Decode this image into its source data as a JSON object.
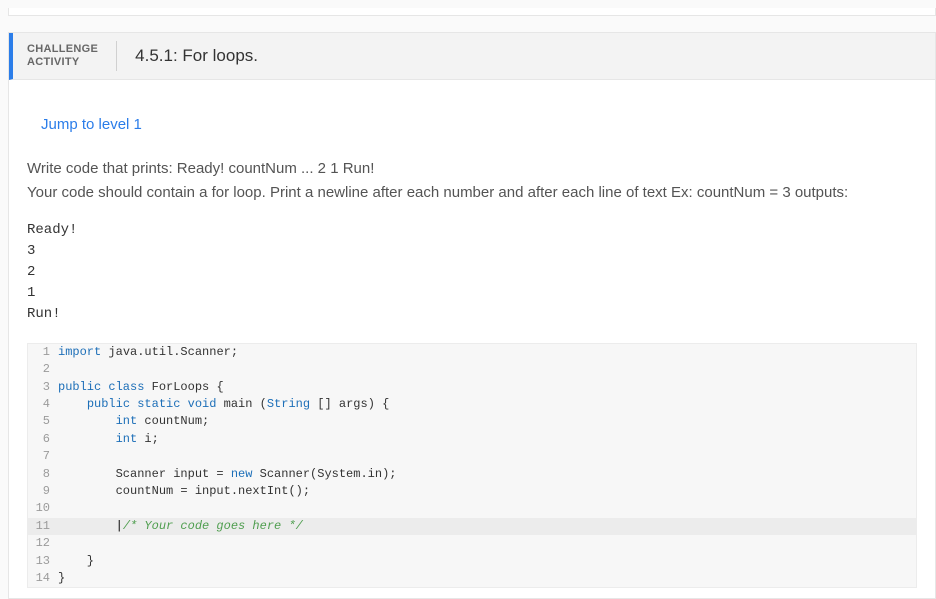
{
  "header": {
    "label_line1": "CHALLENGE",
    "label_line2": "ACTIVITY",
    "title": "4.5.1: For loops."
  },
  "jump_link": "Jump to level 1",
  "instructions": {
    "line1": "Write code that prints: Ready! countNum ... 2 1 Run!",
    "line2": "Your code should contain a for loop. Print a newline after each number and after each line of text Ex: countNum = 3 outputs:"
  },
  "sample_output": "Ready!\n3\n2\n1\nRun!",
  "code": {
    "lines": [
      {
        "n": "1",
        "tokens": [
          {
            "t": "import ",
            "c": "tok-kw"
          },
          {
            "t": "java.util.Scanner;",
            "c": "tok-id"
          }
        ]
      },
      {
        "n": "2",
        "tokens": []
      },
      {
        "n": "3",
        "tokens": [
          {
            "t": "public class ",
            "c": "tok-kw"
          },
          {
            "t": "ForLoops ",
            "c": "tok-cls"
          },
          {
            "t": "{",
            "c": ""
          }
        ]
      },
      {
        "n": "4",
        "tokens": [
          {
            "t": "    ",
            "c": ""
          },
          {
            "t": "public static void ",
            "c": "tok-kw"
          },
          {
            "t": "main ",
            "c": "tok-id"
          },
          {
            "t": "(",
            "c": ""
          },
          {
            "t": "String ",
            "c": "tok-type"
          },
          {
            "t": "[] args) {",
            "c": ""
          }
        ]
      },
      {
        "n": "5",
        "tokens": [
          {
            "t": "        ",
            "c": ""
          },
          {
            "t": "int ",
            "c": "tok-kw"
          },
          {
            "t": "countNum;",
            "c": "tok-id"
          }
        ]
      },
      {
        "n": "6",
        "tokens": [
          {
            "t": "        ",
            "c": ""
          },
          {
            "t": "int ",
            "c": "tok-kw"
          },
          {
            "t": "i;",
            "c": "tok-id"
          }
        ]
      },
      {
        "n": "7",
        "tokens": []
      },
      {
        "n": "8",
        "tokens": [
          {
            "t": "        Scanner input = ",
            "c": ""
          },
          {
            "t": "new ",
            "c": "tok-new"
          },
          {
            "t": "Scanner(",
            "c": ""
          },
          {
            "t": "System",
            "c": "tok-sys"
          },
          {
            "t": ".in);",
            "c": ""
          }
        ]
      },
      {
        "n": "9",
        "tokens": [
          {
            "t": "        countNum = input.nextInt();",
            "c": ""
          }
        ]
      },
      {
        "n": "10",
        "tokens": []
      },
      {
        "n": "11",
        "hl": true,
        "cursor": true,
        "tokens": [
          {
            "t": "        ",
            "c": ""
          },
          {
            "t": "/* Your code goes here */",
            "c": "tok-cm"
          }
        ]
      },
      {
        "n": "12",
        "tokens": []
      },
      {
        "n": "13",
        "tokens": [
          {
            "t": "    }",
            "c": ""
          }
        ]
      },
      {
        "n": "14",
        "tokens": [
          {
            "t": "}",
            "c": ""
          }
        ]
      }
    ]
  }
}
